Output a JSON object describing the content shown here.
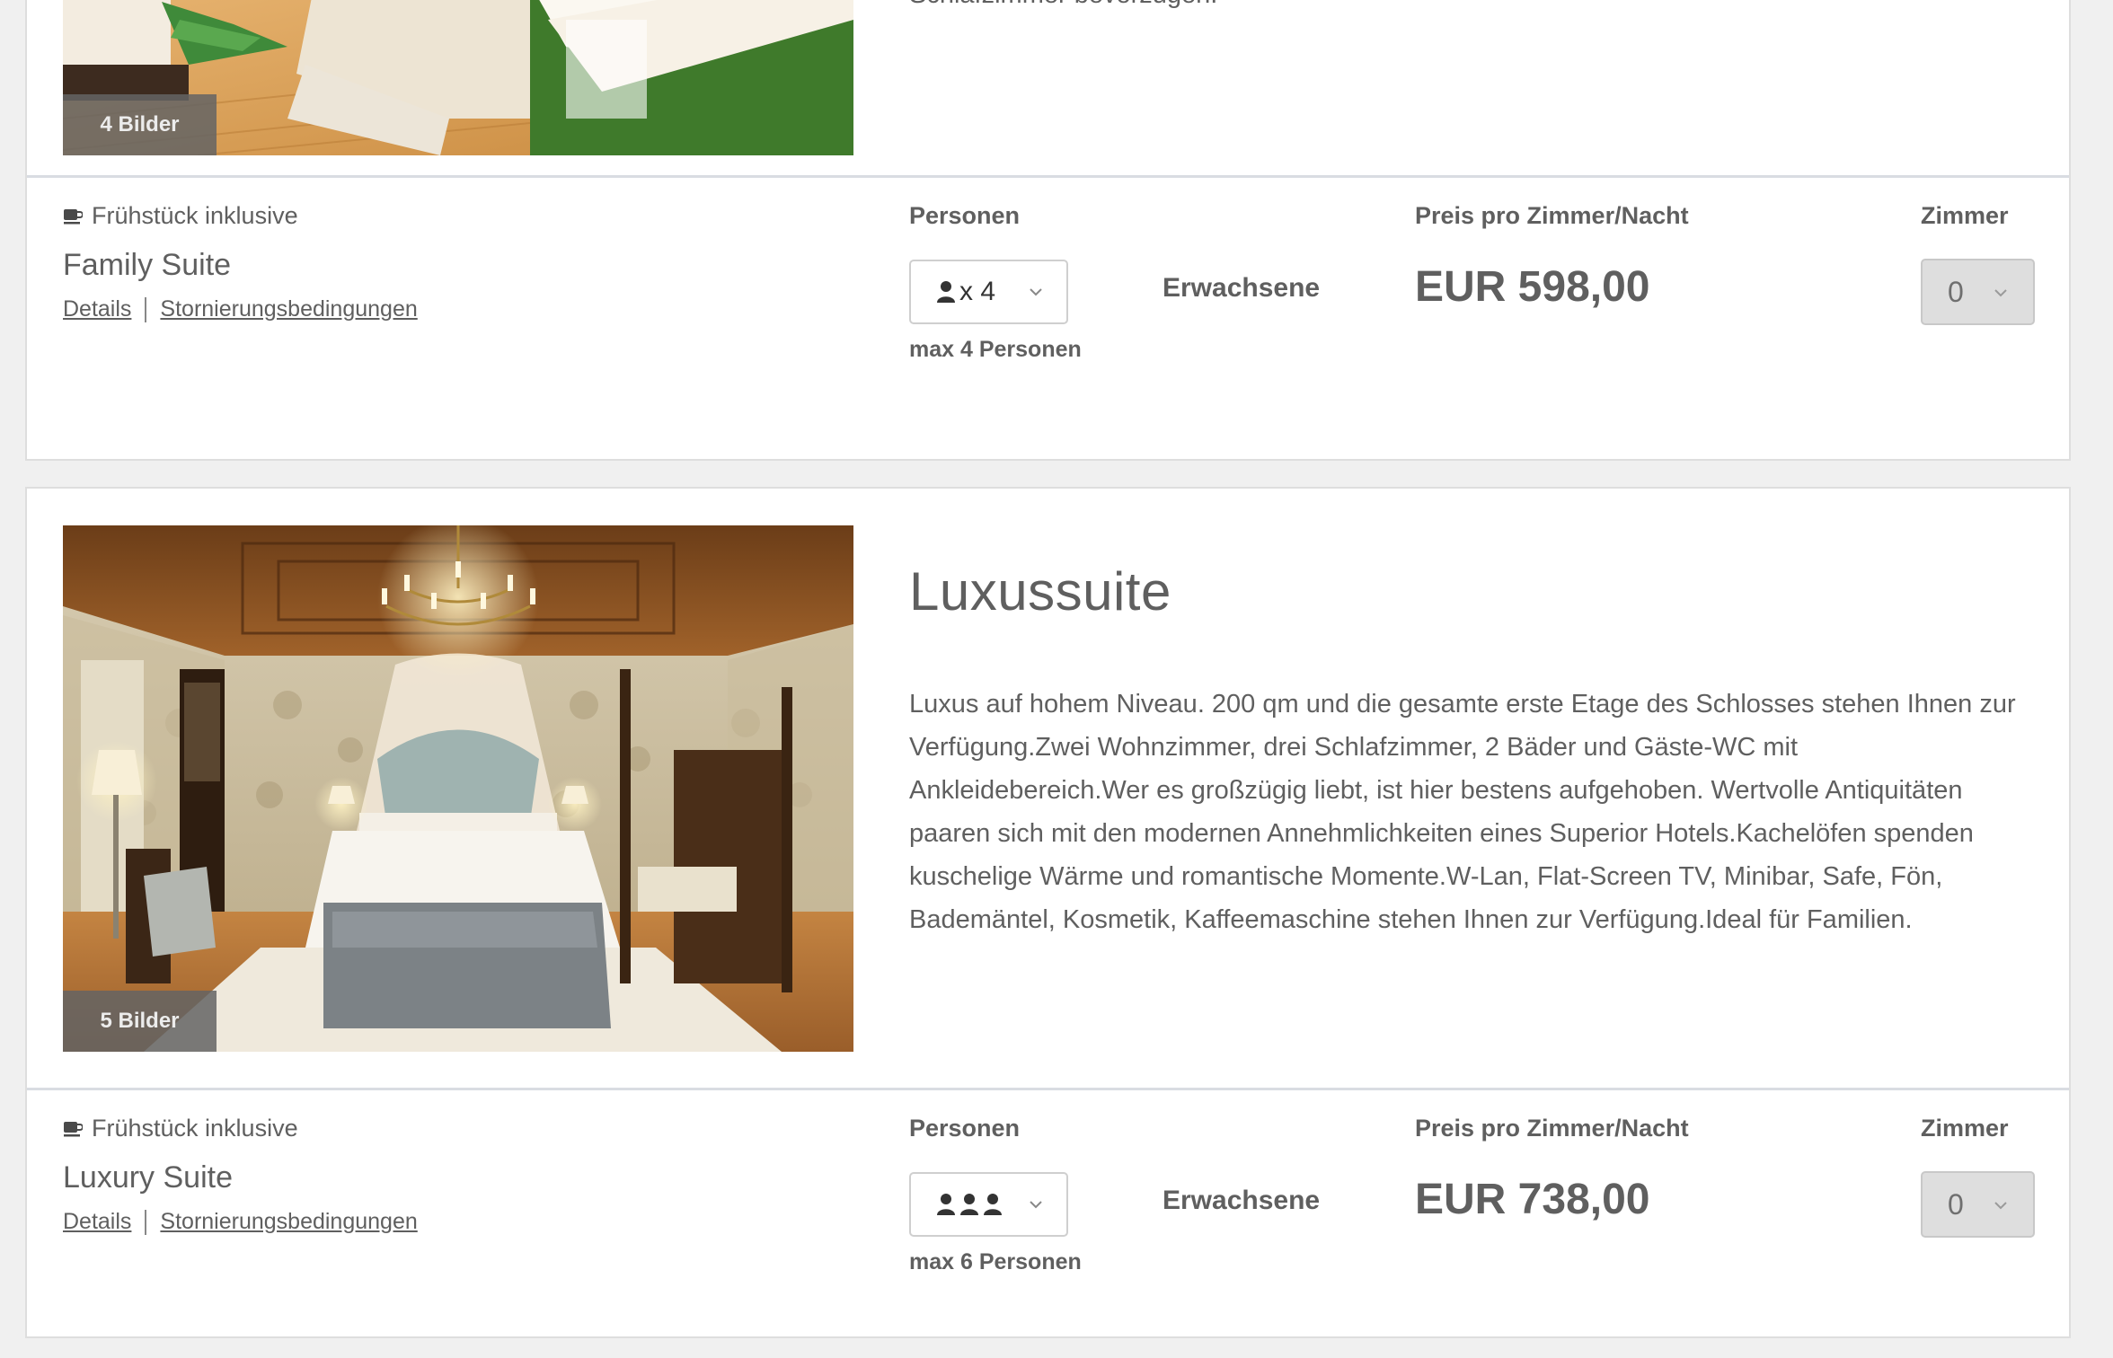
{
  "rooms": [
    {
      "image_badge": "4 Bilder",
      "description_tail": "Schlafzimmer bevorzugen.",
      "rate": {
        "breakfast": "Frühstück inklusive",
        "name": "Family Suite",
        "details_link": "Details",
        "cancellation_link": "Stornierungsbedingungen",
        "persons_label": "Personen",
        "persons_value": "x 4",
        "persons_icon": "single-person-icon",
        "max_persons": "max 4 Personen",
        "adults_label": "Erwachsene",
        "price_label": "Preis pro Zimmer/Nacht",
        "price": "EUR 598,00",
        "rooms_label": "Zimmer",
        "rooms_value": "0"
      }
    },
    {
      "image_badge": "5 Bilder",
      "title": "Luxussuite",
      "description": "Luxus auf hohem Niveau. 200 qm und die gesamte erste Etage des Schlosses stehen Ihnen zur Verfügung.Zwei Wohnzimmer, drei Schlafzimmer, 2 Bäder und Gäste-WC mit Ankleidebereich.Wer es großzügig liebt, ist hier bestens aufgehoben. Wertvolle Antiquitäten paaren sich mit den modernen Annehmlichkeiten eines Superior Hotels.Kachelöfen spenden kuschelige Wärme und romantische Momente.W-Lan, Flat-Screen TV, Minibar, Safe, Fön, Bademäntel, Kosmetik, Kaffeemaschine stehen Ihnen zur Verfügung.Ideal für Familien.",
      "rate": {
        "breakfast": "Frühstück inklusive",
        "name": "Luxury Suite",
        "details_link": "Details",
        "cancellation_link": "Stornierungsbedingungen",
        "persons_label": "Personen",
        "persons_icon": "three-persons-icon",
        "max_persons": "max 6 Personen",
        "adults_label": "Erwachsene",
        "price_label": "Preis pro Zimmer/Nacht",
        "price": "EUR 738,00",
        "rooms_label": "Zimmer",
        "rooms_value": "0"
      }
    }
  ],
  "colors": {
    "text": "#5f5f5f",
    "badge_bg": "#646464",
    "disabled_select": "#dedede"
  }
}
